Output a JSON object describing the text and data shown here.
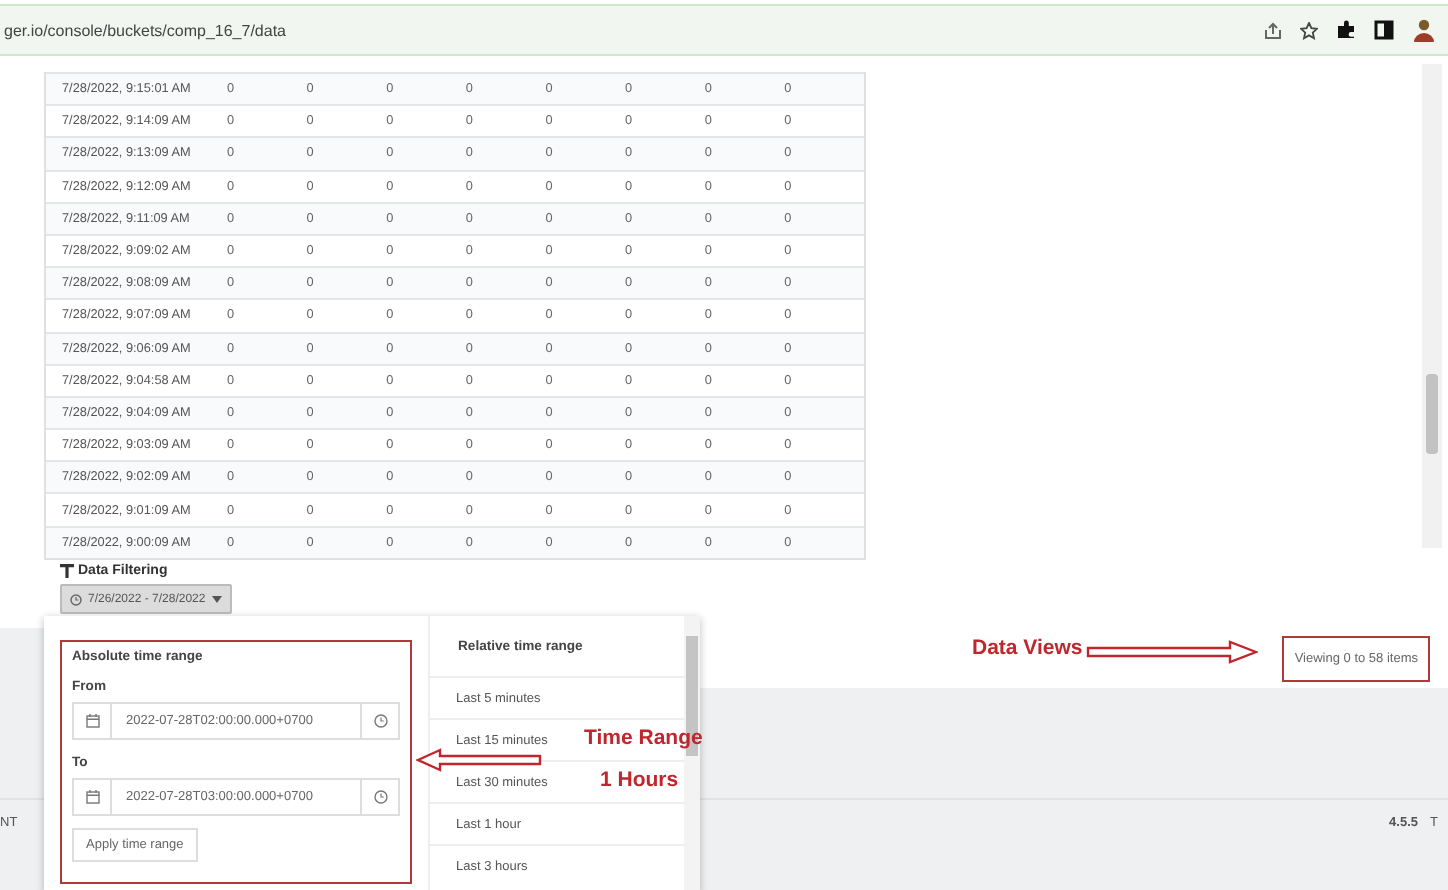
{
  "browser": {
    "url": "ger.io/console/buckets/comp_16_7/data"
  },
  "table": {
    "rows": [
      {
        "time": "7/28/2022, 9:15:01 AM",
        "values": [
          "0",
          "0",
          "0",
          "0",
          "0",
          "0",
          "0",
          "0"
        ]
      },
      {
        "time": "7/28/2022, 9:14:09 AM",
        "values": [
          "0",
          "0",
          "0",
          "0",
          "0",
          "0",
          "0",
          "0"
        ]
      },
      {
        "time": "7/28/2022, 9:13:09 AM",
        "values": [
          "0",
          "0",
          "0",
          "0",
          "0",
          "0",
          "0",
          "0"
        ]
      },
      {
        "time": "7/28/2022, 9:12:09 AM",
        "values": [
          "0",
          "0",
          "0",
          "0",
          "0",
          "0",
          "0",
          "0"
        ]
      },
      {
        "time": "7/28/2022, 9:11:09 AM",
        "values": [
          "0",
          "0",
          "0",
          "0",
          "0",
          "0",
          "0",
          "0"
        ]
      },
      {
        "time": "7/28/2022, 9:09:02 AM",
        "values": [
          "0",
          "0",
          "0",
          "0",
          "0",
          "0",
          "0",
          "0"
        ]
      },
      {
        "time": "7/28/2022, 9:08:09 AM",
        "values": [
          "0",
          "0",
          "0",
          "0",
          "0",
          "0",
          "0",
          "0"
        ]
      },
      {
        "time": "7/28/2022, 9:07:09 AM",
        "values": [
          "0",
          "0",
          "0",
          "0",
          "0",
          "0",
          "0",
          "0"
        ]
      },
      {
        "time": "7/28/2022, 9:06:09 AM",
        "values": [
          "0",
          "0",
          "0",
          "0",
          "0",
          "0",
          "0",
          "0"
        ]
      },
      {
        "time": "7/28/2022, 9:04:58 AM",
        "values": [
          "0",
          "0",
          "0",
          "0",
          "0",
          "0",
          "0",
          "0"
        ]
      },
      {
        "time": "7/28/2022, 9:04:09 AM",
        "values": [
          "0",
          "0",
          "0",
          "0",
          "0",
          "0",
          "0",
          "0"
        ]
      },
      {
        "time": "7/28/2022, 9:03:09 AM",
        "values": [
          "0",
          "0",
          "0",
          "0",
          "0",
          "0",
          "0",
          "0"
        ]
      },
      {
        "time": "7/28/2022, 9:02:09 AM",
        "values": [
          "0",
          "0",
          "0",
          "0",
          "0",
          "0",
          "0",
          "0"
        ]
      },
      {
        "time": "7/28/2022, 9:01:09 AM",
        "values": [
          "0",
          "0",
          "0",
          "0",
          "0",
          "0",
          "0",
          "0"
        ]
      },
      {
        "time": "7/28/2022, 9:00:09 AM",
        "values": [
          "0",
          "0",
          "0",
          "0",
          "0",
          "0",
          "0",
          "0"
        ]
      }
    ]
  },
  "filter": {
    "title": "Data Filtering",
    "range_button": "7/26/2022 - 7/28/2022"
  },
  "time_popup": {
    "absolute": {
      "title": "Absolute time range",
      "from_label": "From",
      "from_value": "2022-07-28T02:00:00.000+0700",
      "to_label": "To",
      "to_value": "2022-07-28T03:00:00.000+0700",
      "apply_button": "Apply time range"
    },
    "relative": {
      "title": "Relative time range",
      "options": [
        "Last 5 minutes",
        "Last 15 minutes",
        "Last 30 minutes",
        "Last 1 hour",
        "Last 3 hours"
      ]
    }
  },
  "footer": {
    "viewing": "Viewing 0 to 58 items",
    "left_text": "NT",
    "version": "4.5.5",
    "version_suffix": "T"
  },
  "annotations": {
    "time_range": "Time Range",
    "time_range_2": "1 Hours",
    "data_views": "Data Views"
  }
}
